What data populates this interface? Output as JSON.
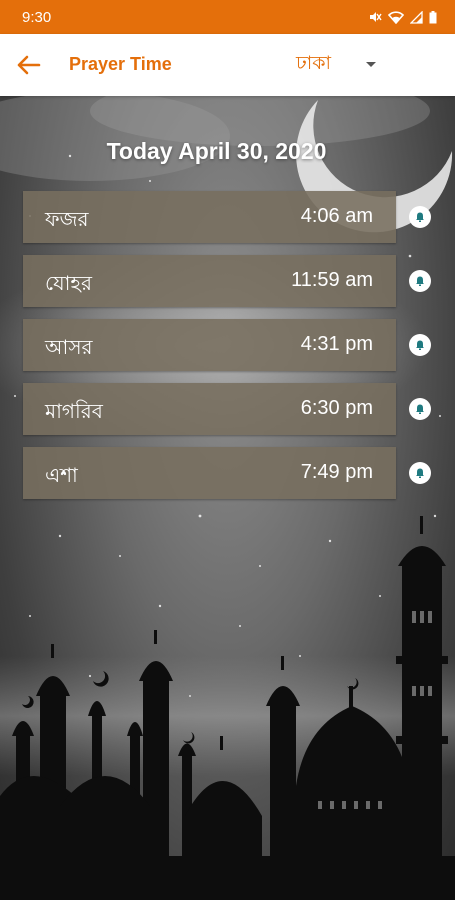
{
  "status_bar": {
    "time": "9:30"
  },
  "app_bar": {
    "title": "Prayer Time",
    "city": "ঢাকা"
  },
  "date_heading": "Today April 30, 2020",
  "prayers": [
    {
      "name": "ফজর",
      "time": "4:06 am"
    },
    {
      "name": "যোহর",
      "time": "11:59 am"
    },
    {
      "name": "আসর",
      "time": "4:31 pm"
    },
    {
      "name": "মাগরিব",
      "time": "6:30 pm"
    },
    {
      "name": "এশা",
      "time": "7:49 pm"
    }
  ],
  "colors": {
    "accent": "#e46f0b",
    "card": "#786e5f",
    "icon": "#1f7a80"
  },
  "icons": [
    "back-arrow-icon",
    "dropdown-caret-icon",
    "alarm-bell-icon",
    "mute-icon",
    "wifi-icon",
    "signal-icon",
    "battery-icon"
  ]
}
